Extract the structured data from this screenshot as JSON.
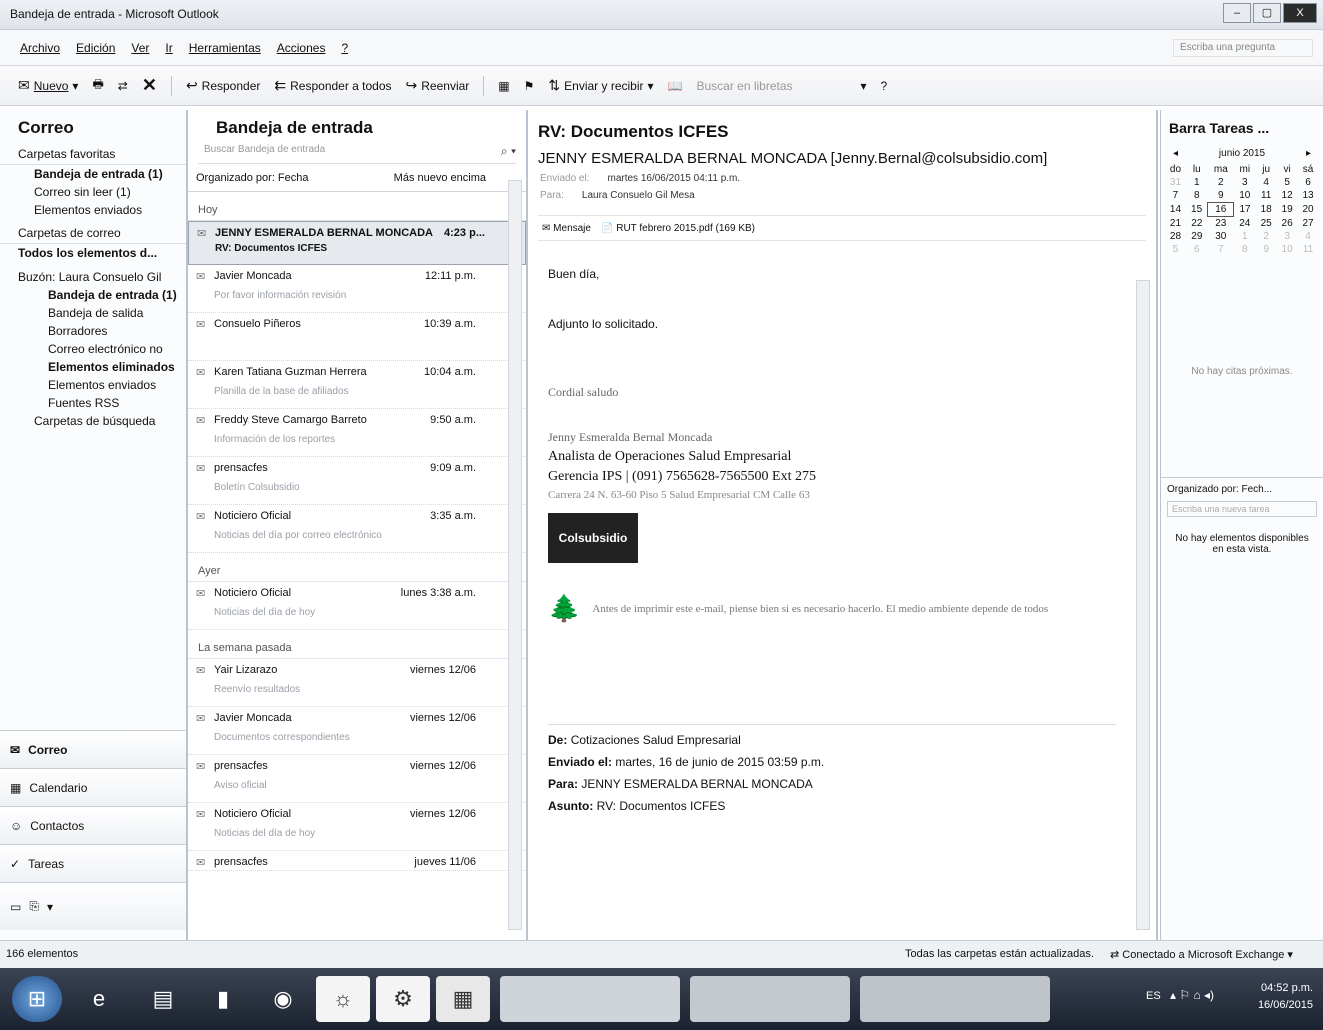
{
  "window": {
    "title": "Bandeja de entrada - Microsoft Outlook",
    "buttons": [
      "–",
      "▢",
      "X"
    ]
  },
  "menu": {
    "items": [
      "Archivo",
      "Edición",
      "Ver",
      "Ir",
      "Herramientas",
      "Acciones",
      "?"
    ],
    "help_placeholder": "Escriba una pregunta"
  },
  "toolbar": {
    "new": "Nuevo",
    "reply": "Responder",
    "reply_all": "Responder a todos",
    "forward": "Reenviar",
    "send_receive": "Enviar y recibir",
    "search_contacts": "Buscar en libretas"
  },
  "nav": {
    "title": "Correo",
    "favorites_header": "Carpetas favoritas",
    "favorites": [
      "Bandeja de entrada (1)",
      "Correo sin leer (1)",
      "Elementos enviados"
    ],
    "folders_header": "Carpetas de correo",
    "all_items": "Todos los elementos d...",
    "mailbox": "Buzón: Laura Consuelo Gil",
    "folders": [
      "Bandeja de entrada (1)",
      "Bandeja de salida",
      "Borradores",
      "Correo electrónico no",
      "Elementos eliminados",
      "Elementos enviados",
      "Fuentes RSS",
      "Carpetas de búsqueda"
    ],
    "buttons": [
      "Correo",
      "Calendario",
      "Contactos",
      "Tareas"
    ]
  },
  "list": {
    "title": "Bandeja de entrada",
    "search_placeholder": "Buscar Bandeja de entrada",
    "sort_by": "Organizado por: Fecha",
    "sort_order": "Más nuevo encima",
    "groups": {
      "today": "Hoy",
      "yesterday": "Ayer",
      "last_week": "La semana pasada"
    },
    "today_items": [
      {
        "from": "JENNY ESMERALDA BERNAL MONCADA",
        "time": "4:23 p...",
        "preview": "RV: Documentos ICFES"
      },
      {
        "from": "Javier Moncada",
        "time": "12:11 p.m.",
        "preview": "Por favor información revisión"
      },
      {
        "from": "Consuelo Piñeros",
        "time": "10:39 a.m.",
        "preview": ""
      },
      {
        "from": "Karen Tatiana Guzman Herrera",
        "time": "10:04 a.m.",
        "preview": "Planilla de la base de afiliados"
      },
      {
        "from": "Freddy Steve Camargo Barreto",
        "time": "9:50 a.m.",
        "preview": "Información de los reportes"
      },
      {
        "from": "prensacfes",
        "time": "9:09 a.m.",
        "preview": "Boletín Colsubsidio"
      },
      {
        "from": "Noticiero Oficial",
        "time": "3:35 a.m.",
        "preview": "Noticias del día por correo electrónico"
      }
    ],
    "yesterday_items": [
      {
        "from": "Noticiero Oficial",
        "time": "lunes 3:38 a.m.",
        "preview": "Noticias del día de hoy"
      }
    ],
    "last_week_items": [
      {
        "from": "Yair Lizarazo",
        "time": "viernes 12/06",
        "preview": "Reenvío resultados"
      },
      {
        "from": "Javier Moncada",
        "time": "viernes 12/06",
        "preview": "Documentos correspondientes"
      },
      {
        "from": "prensacfes",
        "time": "viernes 12/06",
        "preview": "Aviso oficial"
      },
      {
        "from": "Noticiero Oficial",
        "time": "viernes 12/06",
        "preview": "Noticias del día de hoy"
      },
      {
        "from": "prensacfes",
        "time": "jueves 11/06",
        "preview": ""
      }
    ]
  },
  "reading": {
    "subject": "RV: Documentos ICFES",
    "sender": "JENNY ESMERALDA BERNAL MONCADA [Jenny.Bernal@colsubsidio.com]",
    "sent_label": "Enviado el:",
    "sent_value": "martes 16/06/2015 04:11 p.m.",
    "to_label": "Para:",
    "to_value": "Laura Consuelo Gil Mesa",
    "message_tab": "Mensaje",
    "attachment": "RUT febrero 2015.pdf (169 KB)",
    "greeting": "Buen día,",
    "line1": "Adjunto lo solicitado.",
    "closing": "Cordial saludo",
    "sig_name": "Jenny Esmeralda Bernal Moncada",
    "sig_title": "Analista de Operaciones Salud Empresarial",
    "sig_phone": "Gerencia IPS | (091) 7565628-7565500 Ext 275",
    "sig_address": "Carrera 24 N. 63-60 Piso 5 Salud Empresarial CM Calle 63",
    "logo_text": "Colsubsidio",
    "eco_note": "Antes de imprimir este e-mail, piense bien si es necesario hacerlo. El medio ambiente depende de todos",
    "fwd": {
      "from_label": "De:",
      "from_value": "Cotizaciones Salud Empresarial",
      "sent_label": "Enviado el:",
      "sent_value": "martes, 16 de junio de 2015 03:59 p.m.",
      "to_label": "Para:",
      "to_value": "JENNY ESMERALDA BERNAL MONCADA",
      "subject_label": "Asunto:",
      "subject_value": "RV: Documentos ICFES"
    }
  },
  "todo": {
    "title": "Barra Tareas ...",
    "month": "junio 2015",
    "weekdays": [
      "do",
      "lu",
      "ma",
      "mi",
      "ju",
      "vi",
      "sá"
    ],
    "no_appointments": "No hay citas próximas.",
    "sort_by": "Organizado por: Fech...",
    "task_placeholder": "Escriba una nueva tarea",
    "no_items": "No hay elementos disponibles en esta vista."
  },
  "status": {
    "count": "166 elementos",
    "sync": "Todas las carpetas están actualizadas.",
    "connection": "Conectado a Microsoft Exchange"
  },
  "taskbar": {
    "lang": "ES",
    "time": "04:52 p.m.",
    "date": "16/06/2015"
  }
}
